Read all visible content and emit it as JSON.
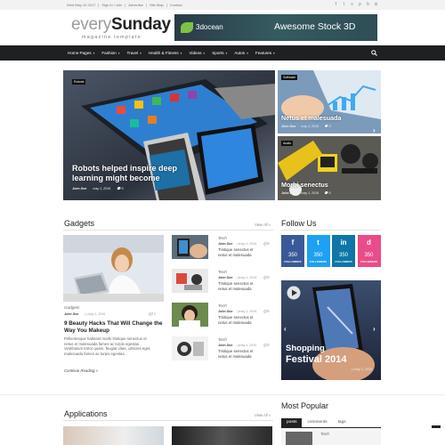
{
  "topbar": {
    "date": "Wed May 10 2017",
    "links": [
      "Sign in / Join",
      "Advertise",
      "Site Map",
      "Contact"
    ]
  },
  "social_icons": [
    "facebook-icon",
    "twitter-icon",
    "vimeo-icon",
    "pinterest-icon",
    "behance-icon",
    "instagram-icon"
  ],
  "logo": {
    "part1": "every",
    "part2": "Sunday",
    "tagline": "magazine template"
  },
  "banner": {
    "brand": "3docean",
    "text": "Awesome Stock 3D"
  },
  "nav": {
    "items": [
      {
        "label": "Home Pages",
        "dropdown": true
      },
      {
        "label": "Fashion",
        "dropdown": true
      },
      {
        "label": "Travel",
        "dropdown": true
      },
      {
        "label": "Health & Fitness",
        "dropdown": true
      },
      {
        "label": "Videos",
        "dropdown": true
      },
      {
        "label": "Sports",
        "dropdown": true
      },
      {
        "label": "Autos",
        "dropdown": true
      },
      {
        "label": "Features",
        "dropdown": true
      }
    ]
  },
  "hero": {
    "main": {
      "category": "Robots",
      "title_line1": "Robots helped inspire deep",
      "title_line2": "learning might become",
      "author": "John Doe",
      "date": "may 1, 2016",
      "comments": "0"
    },
    "top_right": {
      "category": "Software",
      "title": "Netus et malesuada",
      "author": "John Doe",
      "date": "may 1, 2016",
      "comments": "0"
    },
    "bottom_right": {
      "category": "Audio",
      "title": "Morbi senectus",
      "author": "John Doe",
      "date": "may 1, 2016",
      "comments": "0"
    }
  },
  "gadgets": {
    "title": "Gadgets",
    "view_all": "View All »",
    "main": {
      "category": "Gadgets",
      "author": "John Doe",
      "date": "may 1, 2016",
      "comments": "0",
      "headline_line1": "9 Beauty Hacks That Will Change the",
      "headline_line2": "Way You Makeup",
      "excerpt": [
        "Pellentesque habitant morbi tristique senectus et",
        "netus et malesuada fames ac turpis egestas.",
        "Vestibulum tortor quam, feugiat vitae, ultricies eget,",
        "malesuada fames ac turpis egestas."
      ],
      "continue": "Continue Reading »"
    },
    "list": [
      {
        "category": "Tech",
        "author": "John Doe",
        "date": "may 1, 2016",
        "comments": "0",
        "line1": "Tristique senectus et",
        "line2": "netus et malesuada"
      },
      {
        "category": "Tech",
        "author": "John Doe",
        "date": "may 1, 2016",
        "comments": "0",
        "line1": "Tristique senectus et",
        "line2": "netus et malesuada"
      },
      {
        "category": "Tech",
        "author": "John Doe",
        "date": "may 1, 2016",
        "comments": "0",
        "line1": "Tristique senectus et",
        "line2": "netus et malesuada"
      },
      {
        "category": "Tech",
        "author": "John Doe",
        "date": "may 1, 2016",
        "comments": "0",
        "line1": "Tristique senectus et",
        "line2": "netus et malesuada"
      }
    ]
  },
  "follow": {
    "title": "Follow Us",
    "tiles": [
      {
        "icon": "f",
        "count": "350",
        "label": "FOLLOWERS",
        "color": "#3b5998"
      },
      {
        "icon": "t",
        "count": "350",
        "label": "FOLLOWERS",
        "color": "#1da1f2"
      },
      {
        "icon": "in",
        "count": "350",
        "label": "FOLLOWERS",
        "color": "#0e76a8"
      },
      {
        "icon": "d",
        "count": "350",
        "label": "FOLLOWERS",
        "color": "#ea4c89"
      }
    ]
  },
  "promo": {
    "line1": "Shopping",
    "line2": "Festival 2014",
    "date": "may 1, 2016"
  },
  "applications": {
    "title": "Applications",
    "view_all": "View All »"
  },
  "most_popular": {
    "title": "Most Popular",
    "tabs": [
      "posts",
      "comments",
      "tags"
    ],
    "first_category": "Tech"
  },
  "colors": {
    "nav_bg": "#1e2024",
    "accent_dark": "#111111"
  }
}
